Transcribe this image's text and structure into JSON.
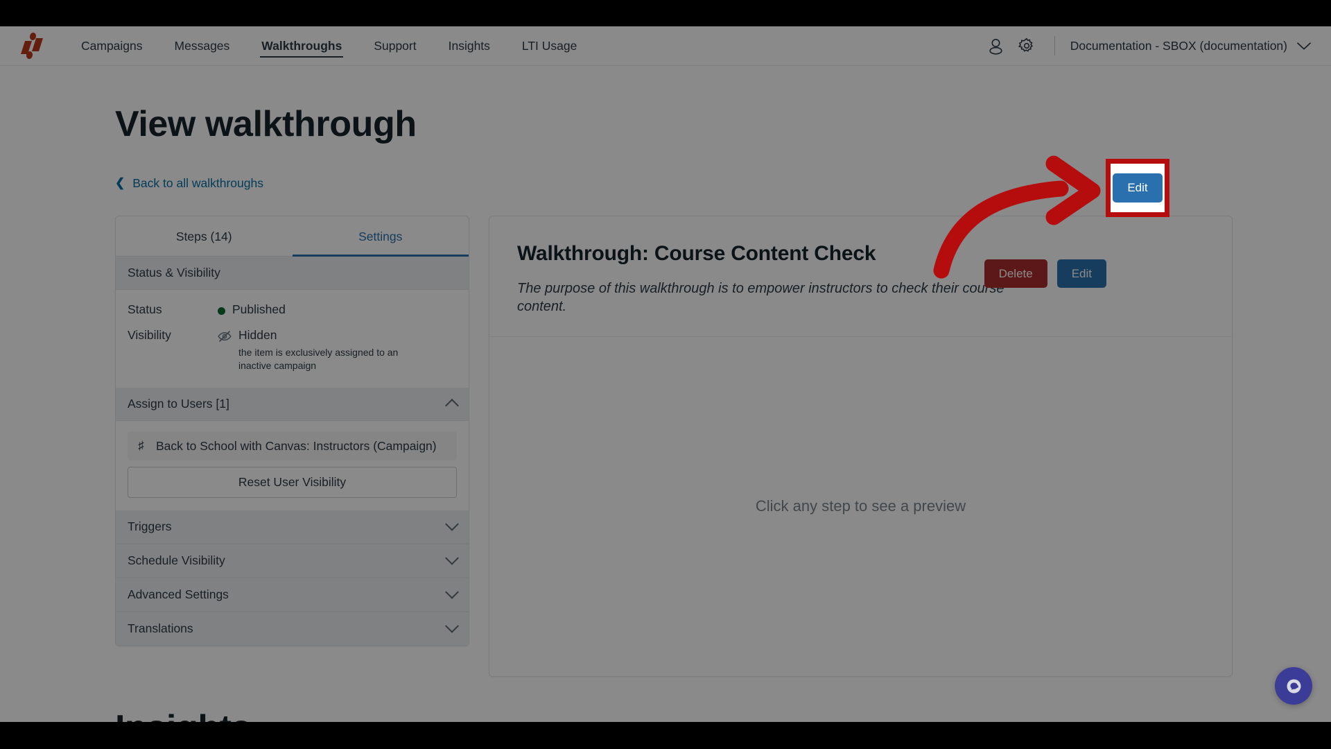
{
  "nav": {
    "logo_name": "product-logo",
    "links": [
      {
        "label": "Campaigns",
        "active": false
      },
      {
        "label": "Messages",
        "active": false
      },
      {
        "label": "Walkthroughs",
        "active": true
      },
      {
        "label": "Support",
        "active": false
      },
      {
        "label": "Insights",
        "active": false
      },
      {
        "label": "LTI Usage",
        "active": false
      }
    ],
    "user_icon": "user-icon",
    "settings_icon": "gear-icon",
    "account": "Documentation - SBOX (documentation)",
    "account_caret": "chevron-down-icon"
  },
  "page": {
    "title": "View walkthrough",
    "back_link": "Back to all walkthroughs",
    "back_chevron": "chevron-left-icon"
  },
  "actions": {
    "delete_label": "Delete",
    "edit_label": "Edit",
    "delete_color": "#ab2d2d",
    "edit_color": "#2a6fae"
  },
  "left_panel": {
    "tabs": [
      {
        "label": "Steps (14)",
        "active": false
      },
      {
        "label": "Settings",
        "active": true
      }
    ],
    "status_visibility": {
      "header": "Status & Visibility",
      "rows": [
        {
          "label": "Status",
          "value": "Published",
          "indicator": "status-dot",
          "indicator_color": "#0b6b2f",
          "note": ""
        },
        {
          "label": "Visibility",
          "value": "Hidden",
          "indicator": "eye-off-icon",
          "indicator_color": "#6b7780",
          "note": "the item is exclusively assigned to an inactive campaign"
        }
      ]
    },
    "assign_to_users": {
      "header": "Assign to Users [1]",
      "expanded": true,
      "chip_icon": "hash-icon",
      "chip_label": "Back to School with Canvas: Instructors (Campaign)",
      "reset_button": "Reset User Visibility"
    },
    "collapsed_sections": [
      {
        "label": "Triggers"
      },
      {
        "label": "Schedule Visibility"
      },
      {
        "label": "Advanced Settings"
      },
      {
        "label": "Translations"
      }
    ]
  },
  "right_panel": {
    "title": "Walkthrough: Course Content Check",
    "description": "The purpose of this walkthrough is to empower instructors to check their course content.",
    "empty_state": "Click any step to see a preview"
  },
  "below": {
    "insights_heading": "Insights"
  },
  "chat": {
    "icon": "chat-bubble-icon",
    "color": "#3b3b98"
  },
  "annotation": {
    "arrow_color": "#b50d0d",
    "highlight_border_color": "#b50d0d",
    "target": "edit-button"
  }
}
